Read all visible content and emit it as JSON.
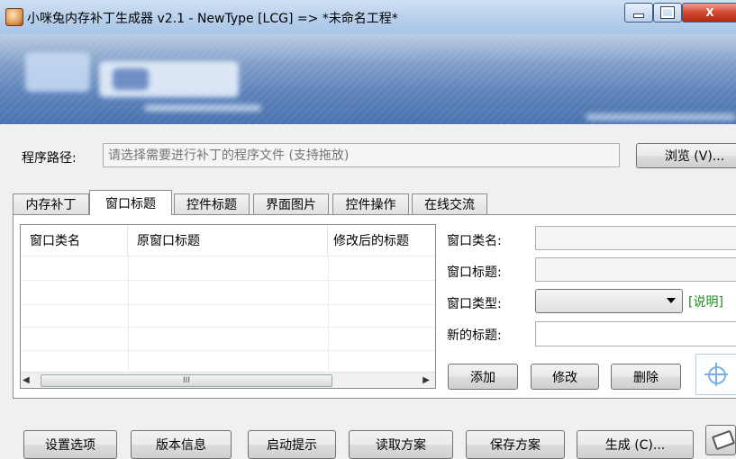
{
  "window": {
    "title": "小咪兔内存补丁生成器 v2.1  -  NewType [LCG]   =>   *未命名工程*",
    "close_glyph": "X"
  },
  "path": {
    "label": "程序路径:",
    "placeholder": "请选择需要进行补丁的程序文件 (支持拖放)",
    "browse_label": "浏览 (V)..."
  },
  "tabs": [
    {
      "label": "内存补丁"
    },
    {
      "label": "窗口标题"
    },
    {
      "label": "控件标题"
    },
    {
      "label": "界面图片"
    },
    {
      "label": "控件操作"
    },
    {
      "label": "在线交流"
    }
  ],
  "list": {
    "columns": [
      "窗口类名",
      "原窗口标题",
      "修改后的标题"
    ],
    "scroll_thumb": "III"
  },
  "form": {
    "class_label": "窗口类名:",
    "title_label": "窗口标题:",
    "type_label": "窗口类型:",
    "type_value": "",
    "help_label": "[说明]",
    "new_title_label": "新的标题:",
    "add_label": "添加",
    "modify_label": "修改",
    "delete_label": "删除"
  },
  "footer": {
    "settings_label": "设置选项",
    "version_label": "版本信息",
    "startup_label": "启动提示",
    "load_label": "读取方案",
    "save_label": "保存方案",
    "generate_label": "生成 (C)..."
  },
  "colors": {
    "help_link": "#1a8f1a",
    "banner": "#5d83bb"
  }
}
